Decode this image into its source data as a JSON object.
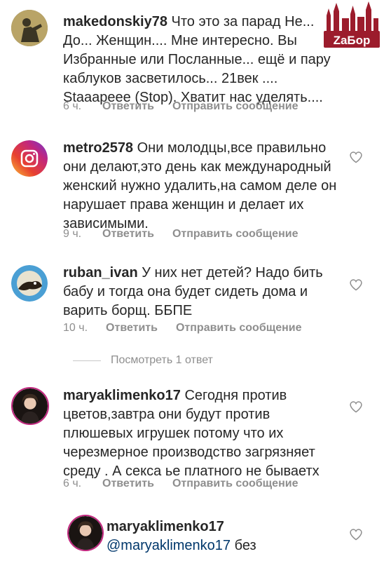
{
  "comments": [
    {
      "username": "makedonskiy78",
      "text": " Что это за парад Не... До... Женщин.... Мне интересно.  Вы Избранные или Посланные... ещё и пару каблуков засветилось... 21век .... Staaapeee (Stop). Хватит нас уделять....",
      "time": "6 ч.",
      "reply_label": "Ответить",
      "message_label": "Отправить сообщение"
    },
    {
      "username": "metro2578",
      "text": " Они молодцы,все правильно они делают,это день как международный женский нужно удалить,на самом деле он нарушает права женщин и делает их зависимыми.",
      "time": "9 ч.",
      "reply_label": "Ответить",
      "message_label": "Отправить сообщение"
    },
    {
      "username": "ruban_ivan",
      "text": " У них нет детей? Надо бить бабу и тогда она будет сидеть дома и варить борщ. ББПЕ",
      "time": "10 ч.",
      "reply_label": "Ответить",
      "message_label": "Отправить сообщение"
    },
    {
      "username": "maryaklimenko17",
      "text": " Сегодня против цветов,завтра они будут против плюшевых игрушек потому что их черезмерное производство  загрязняет среду . А секса ье платного не бываетх",
      "time": "6 ч.",
      "reply_label": "Ответить",
      "message_label": "Отправить сообщение"
    }
  ],
  "view_replies": "Посмотреть 1 ответ",
  "reply": {
    "username": "maryaklimenko17",
    "mention": "@maryaklimenko17",
    "text": " без"
  },
  "watermark": "ZaБор",
  "colors": {
    "text": "#262626",
    "muted": "#8e8e8e",
    "mention": "#00376b",
    "logo": "#9c1c2c"
  }
}
